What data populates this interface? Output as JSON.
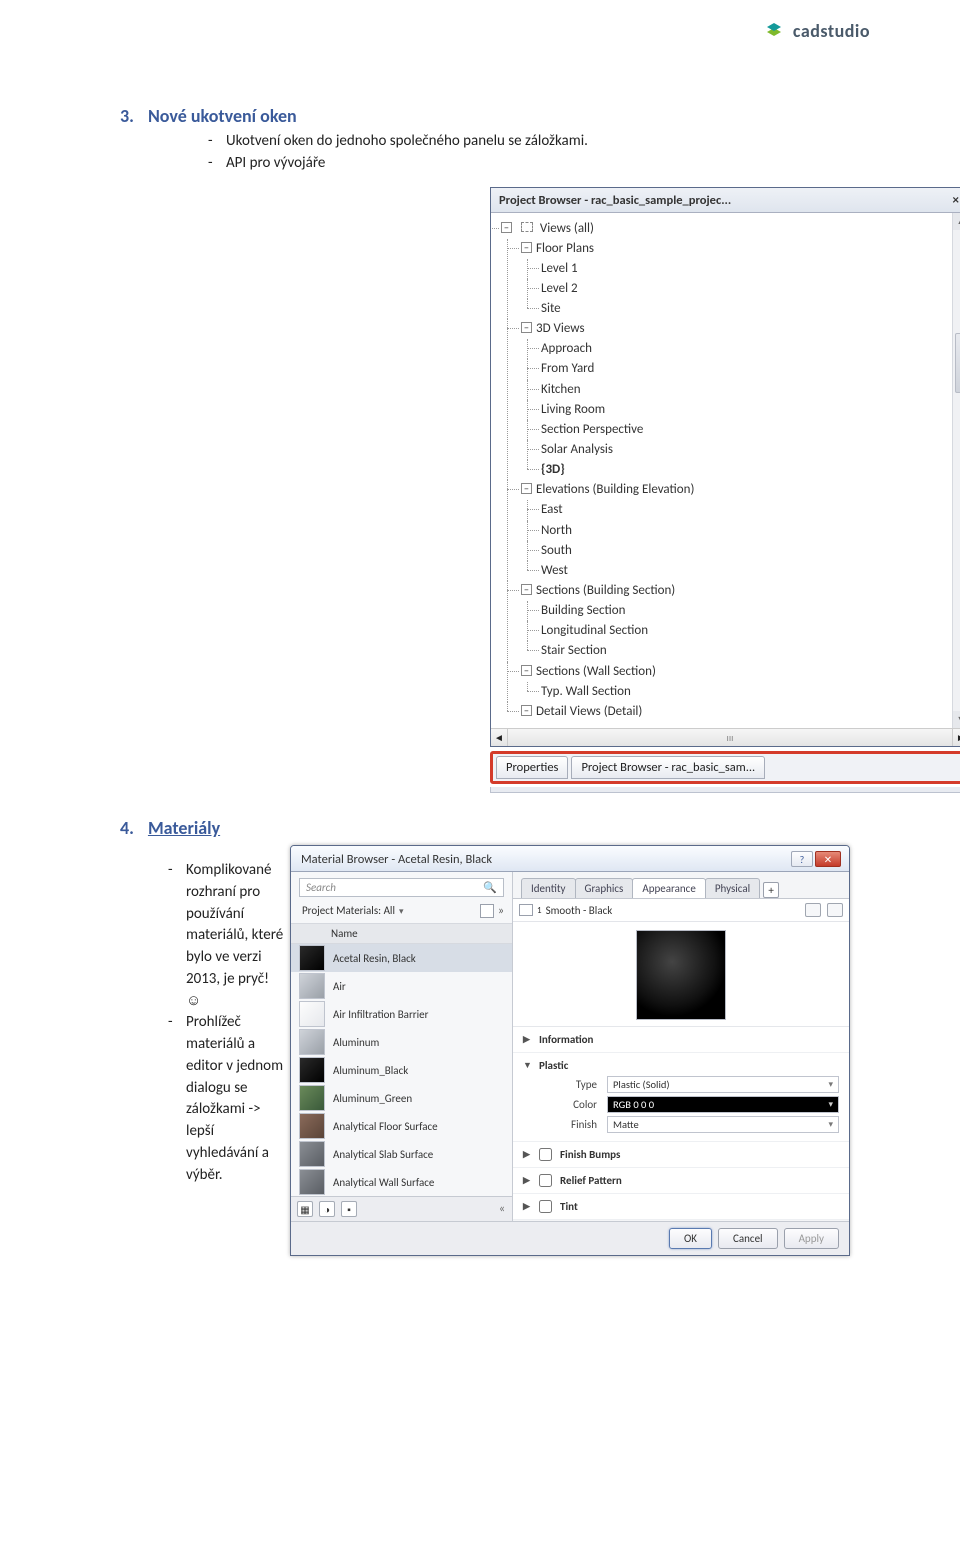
{
  "logo": {
    "text": "cadstudio"
  },
  "section3": {
    "num": "3.",
    "title": "Nové ukotvení oken",
    "bullets": [
      "Ukotvení oken do jednoho společného panelu se záložkami.",
      "API pro vývojáře"
    ],
    "panel_title": "Project Browser - rac_basic_sample_projec...",
    "close": "×",
    "tree": {
      "root": "Views (all)",
      "groups": [
        {
          "name": "Floor Plans",
          "items": [
            "Level 1",
            "Level 2",
            "Site"
          ]
        },
        {
          "name": "3D Views",
          "items": [
            "Approach",
            "From Yard",
            "Kitchen",
            "Living Room",
            "Section Perspective",
            "Solar Analysis",
            "{3D}"
          ],
          "bold_last": true
        },
        {
          "name": "Elevations (Building Elevation)",
          "items": [
            "East",
            "North",
            "South",
            "West"
          ]
        },
        {
          "name": "Sections (Building Section)",
          "items": [
            "Building Section",
            "Longitudinal Section",
            "Stair Section"
          ]
        },
        {
          "name": "Sections (Wall Section)",
          "items": [
            "Typ. Wall Section"
          ]
        },
        {
          "name": "Detail Views (Detail)",
          "items": []
        }
      ]
    },
    "tabs": [
      "Properties",
      "Project Browser - rac_basic_sam..."
    ]
  },
  "section4": {
    "num": "4.",
    "title": "Materiály",
    "bullets": [
      "Komplikované rozhraní pro používání materiálů, které bylo ve verzi 2013, je pryč! ☺",
      "Prohlížeč materiálů a editor v jednom dialogu se záložkami -> lepší vyhledávání a výběr."
    ],
    "dialog_title": "Material Browser - Acetal Resin, Black",
    "search_placeholder": "Search",
    "filter_label": "Project Materials: All",
    "list_header": "Name",
    "materials": [
      {
        "name": "Acetal Resin, Black",
        "swatch": "dark",
        "selected": true
      },
      {
        "name": "Air",
        "swatch": "steel"
      },
      {
        "name": "Air Infiltration Barrier",
        "swatch": "white"
      },
      {
        "name": "Aluminum",
        "swatch": "steel"
      },
      {
        "name": "Aluminum_Black",
        "swatch": "dark"
      },
      {
        "name": "Aluminum_Green",
        "swatch": "green"
      },
      {
        "name": "Analytical Floor Surface",
        "swatch": "brown"
      },
      {
        "name": "Analytical Slab Surface",
        "swatch": "grey"
      },
      {
        "name": "Analytical Wall Surface",
        "swatch": "grey"
      }
    ],
    "tabs": [
      "Identity",
      "Graphics",
      "Appearance",
      "Physical"
    ],
    "active_tab": 2,
    "sub_header": "Smooth - Black",
    "section_info": "Information",
    "section_plastic": "Plastic",
    "props": {
      "type_label": "Type",
      "type_value": "Plastic (Solid)",
      "color_label": "Color",
      "color_value": "RGB 0 0 0",
      "finish_label": "Finish",
      "finish_value": "Matte"
    },
    "section_bumps": "Finish Bumps",
    "section_relief": "Relief Pattern",
    "section_tint": "Tint",
    "buttons": {
      "ok": "OK",
      "cancel": "Cancel",
      "apply": "Apply"
    },
    "chev": "«"
  }
}
